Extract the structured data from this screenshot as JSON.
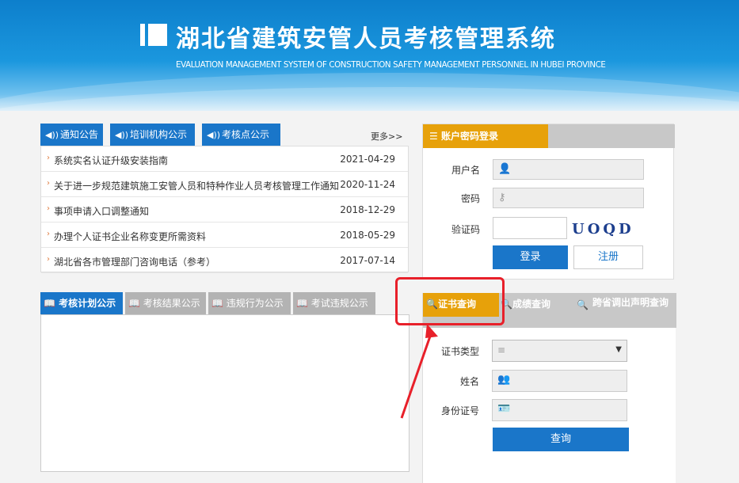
{
  "banner": {
    "title": "湖北省建筑安管人员考核管理系统",
    "subtitle": "EVALUATION MANAGEMENT SYSTEM OF CONSTRUCTION SAFETY MANAGEMENT PERSONNEL IN HUBEI PROVINCE"
  },
  "notice": {
    "tabs": [
      "通知公告",
      "培训机构公示",
      "考核点公示"
    ],
    "more": "更多>>",
    "items": [
      {
        "text": "系统实名认证升级安装指南",
        "date": "2021-04-29"
      },
      {
        "text": "关于进一步规范建筑施工安管人员和特种作业人员考核管理工作通知",
        "date": "2020-11-24"
      },
      {
        "text": "事项申请入口调整通知",
        "date": "2018-12-29"
      },
      {
        "text": "办理个人证书企业名称变更所需资料",
        "date": "2018-05-29"
      },
      {
        "text": "湖北省各市管理部门咨询电话（参考）",
        "date": "2017-07-14"
      }
    ]
  },
  "login": {
    "tab": "账户密码登录",
    "username_label": "用户名",
    "password_label": "密码",
    "captcha_label": "验证码",
    "captcha_text": "UOQD",
    "login_button": "登录",
    "register_button": "注册"
  },
  "exam": {
    "tabs": [
      "考核计划公示",
      "考核结果公示",
      "违规行为公示",
      "考试违规公示"
    ]
  },
  "cert": {
    "tabs": [
      "证书查询",
      "成绩查询",
      "跨省调出声明查询"
    ],
    "type_label": "证书类型",
    "name_label": "姓名",
    "id_label": "身份证号",
    "query_button": "查询"
  },
  "colors": {
    "primary_blue": "#1a76c9",
    "accent_orange": "#e7a10a",
    "highlight_red": "#e8202a"
  }
}
